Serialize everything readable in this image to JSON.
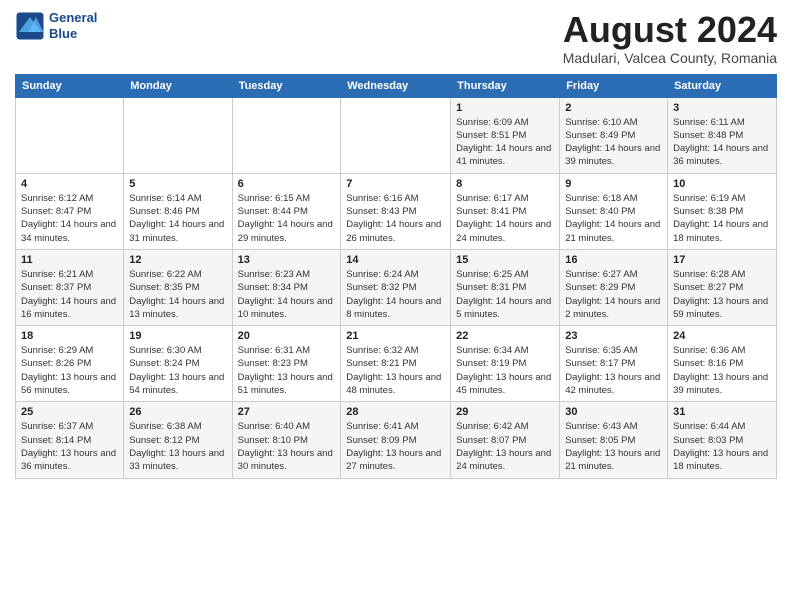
{
  "logo": {
    "line1": "General",
    "line2": "Blue"
  },
  "title": "August 2024",
  "subtitle": "Madulari, Valcea County, Romania",
  "weekdays": [
    "Sunday",
    "Monday",
    "Tuesday",
    "Wednesday",
    "Thursday",
    "Friday",
    "Saturday"
  ],
  "weeks": [
    [
      {
        "day": "",
        "info": ""
      },
      {
        "day": "",
        "info": ""
      },
      {
        "day": "",
        "info": ""
      },
      {
        "day": "",
        "info": ""
      },
      {
        "day": "1",
        "info": "Sunrise: 6:09 AM\nSunset: 8:51 PM\nDaylight: 14 hours and 41 minutes."
      },
      {
        "day": "2",
        "info": "Sunrise: 6:10 AM\nSunset: 8:49 PM\nDaylight: 14 hours and 39 minutes."
      },
      {
        "day": "3",
        "info": "Sunrise: 6:11 AM\nSunset: 8:48 PM\nDaylight: 14 hours and 36 minutes."
      }
    ],
    [
      {
        "day": "4",
        "info": "Sunrise: 6:12 AM\nSunset: 8:47 PM\nDaylight: 14 hours and 34 minutes."
      },
      {
        "day": "5",
        "info": "Sunrise: 6:14 AM\nSunset: 8:46 PM\nDaylight: 14 hours and 31 minutes."
      },
      {
        "day": "6",
        "info": "Sunrise: 6:15 AM\nSunset: 8:44 PM\nDaylight: 14 hours and 29 minutes."
      },
      {
        "day": "7",
        "info": "Sunrise: 6:16 AM\nSunset: 8:43 PM\nDaylight: 14 hours and 26 minutes."
      },
      {
        "day": "8",
        "info": "Sunrise: 6:17 AM\nSunset: 8:41 PM\nDaylight: 14 hours and 24 minutes."
      },
      {
        "day": "9",
        "info": "Sunrise: 6:18 AM\nSunset: 8:40 PM\nDaylight: 14 hours and 21 minutes."
      },
      {
        "day": "10",
        "info": "Sunrise: 6:19 AM\nSunset: 8:38 PM\nDaylight: 14 hours and 18 minutes."
      }
    ],
    [
      {
        "day": "11",
        "info": "Sunrise: 6:21 AM\nSunset: 8:37 PM\nDaylight: 14 hours and 16 minutes."
      },
      {
        "day": "12",
        "info": "Sunrise: 6:22 AM\nSunset: 8:35 PM\nDaylight: 14 hours and 13 minutes."
      },
      {
        "day": "13",
        "info": "Sunrise: 6:23 AM\nSunset: 8:34 PM\nDaylight: 14 hours and 10 minutes."
      },
      {
        "day": "14",
        "info": "Sunrise: 6:24 AM\nSunset: 8:32 PM\nDaylight: 14 hours and 8 minutes."
      },
      {
        "day": "15",
        "info": "Sunrise: 6:25 AM\nSunset: 8:31 PM\nDaylight: 14 hours and 5 minutes."
      },
      {
        "day": "16",
        "info": "Sunrise: 6:27 AM\nSunset: 8:29 PM\nDaylight: 14 hours and 2 minutes."
      },
      {
        "day": "17",
        "info": "Sunrise: 6:28 AM\nSunset: 8:27 PM\nDaylight: 13 hours and 59 minutes."
      }
    ],
    [
      {
        "day": "18",
        "info": "Sunrise: 6:29 AM\nSunset: 8:26 PM\nDaylight: 13 hours and 56 minutes."
      },
      {
        "day": "19",
        "info": "Sunrise: 6:30 AM\nSunset: 8:24 PM\nDaylight: 13 hours and 54 minutes."
      },
      {
        "day": "20",
        "info": "Sunrise: 6:31 AM\nSunset: 8:23 PM\nDaylight: 13 hours and 51 minutes."
      },
      {
        "day": "21",
        "info": "Sunrise: 6:32 AM\nSunset: 8:21 PM\nDaylight: 13 hours and 48 minutes."
      },
      {
        "day": "22",
        "info": "Sunrise: 6:34 AM\nSunset: 8:19 PM\nDaylight: 13 hours and 45 minutes."
      },
      {
        "day": "23",
        "info": "Sunrise: 6:35 AM\nSunset: 8:17 PM\nDaylight: 13 hours and 42 minutes."
      },
      {
        "day": "24",
        "info": "Sunrise: 6:36 AM\nSunset: 8:16 PM\nDaylight: 13 hours and 39 minutes."
      }
    ],
    [
      {
        "day": "25",
        "info": "Sunrise: 6:37 AM\nSunset: 8:14 PM\nDaylight: 13 hours and 36 minutes."
      },
      {
        "day": "26",
        "info": "Sunrise: 6:38 AM\nSunset: 8:12 PM\nDaylight: 13 hours and 33 minutes."
      },
      {
        "day": "27",
        "info": "Sunrise: 6:40 AM\nSunset: 8:10 PM\nDaylight: 13 hours and 30 minutes."
      },
      {
        "day": "28",
        "info": "Sunrise: 6:41 AM\nSunset: 8:09 PM\nDaylight: 13 hours and 27 minutes."
      },
      {
        "day": "29",
        "info": "Sunrise: 6:42 AM\nSunset: 8:07 PM\nDaylight: 13 hours and 24 minutes."
      },
      {
        "day": "30",
        "info": "Sunrise: 6:43 AM\nSunset: 8:05 PM\nDaylight: 13 hours and 21 minutes."
      },
      {
        "day": "31",
        "info": "Sunrise: 6:44 AM\nSunset: 8:03 PM\nDaylight: 13 hours and 18 minutes."
      }
    ]
  ]
}
